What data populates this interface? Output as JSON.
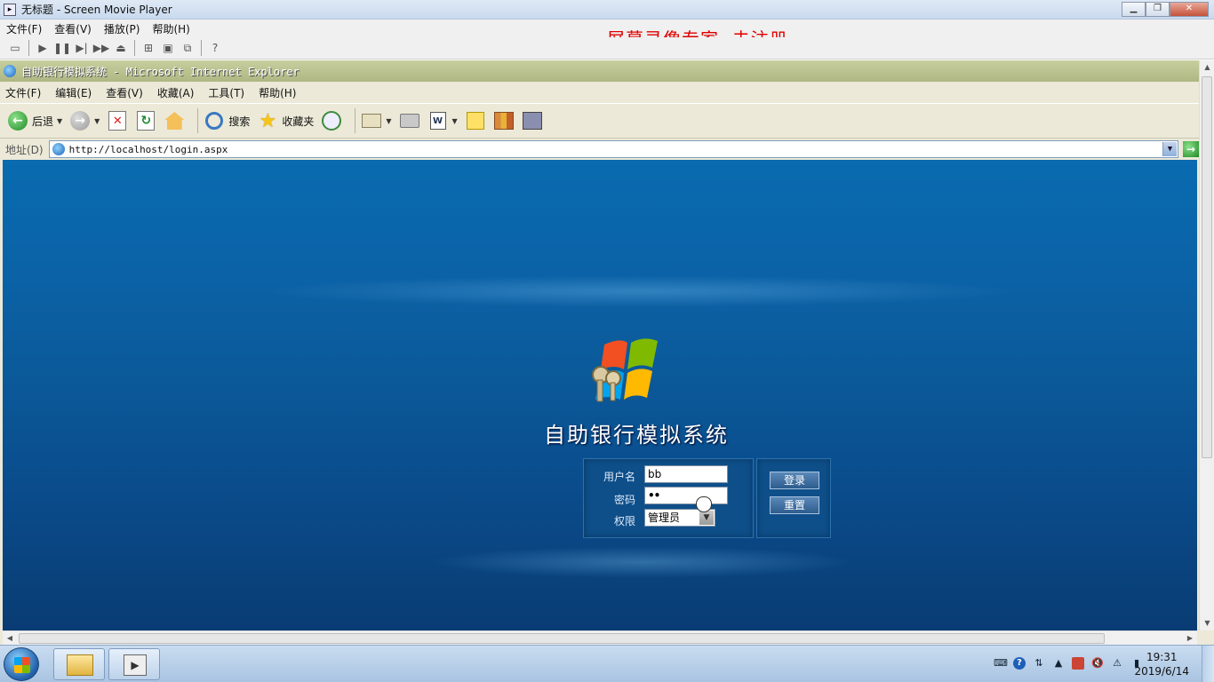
{
  "player": {
    "title": "无标题 - Screen Movie Player",
    "menu": [
      "文件(F)",
      "查看(V)",
      "播放(P)",
      "帮助(H)"
    ],
    "watermark": "屏幕录像专家  未注册"
  },
  "ie": {
    "title": "自助银行模拟系统 - Microsoft Internet Explorer",
    "menu": [
      "文件(F)",
      "编辑(E)",
      "查看(V)",
      "收藏(A)",
      "工具(T)",
      "帮助(H)"
    ],
    "toolbar": {
      "back_label": "后退",
      "search_label": "搜索",
      "favorites_label": "收藏夹"
    },
    "address": {
      "label": "地址(D)",
      "url": "http://localhost/login.aspx"
    }
  },
  "page": {
    "title": "自助银行模拟系统",
    "username_label": "用户名",
    "username_value": "bb",
    "password_label": "密码",
    "password_value": "••",
    "role_label": "权限",
    "role_value": "管理员",
    "login_button": "登录",
    "reset_button": "重置"
  },
  "taskbar": {
    "time": "19:31",
    "date": "2019/6/14"
  },
  "colors": {
    "page_blue_top": "#0a6bb0",
    "page_blue_bottom": "#093c73",
    "watermark_red": "#e00000",
    "ie_title": "#aeb783"
  }
}
